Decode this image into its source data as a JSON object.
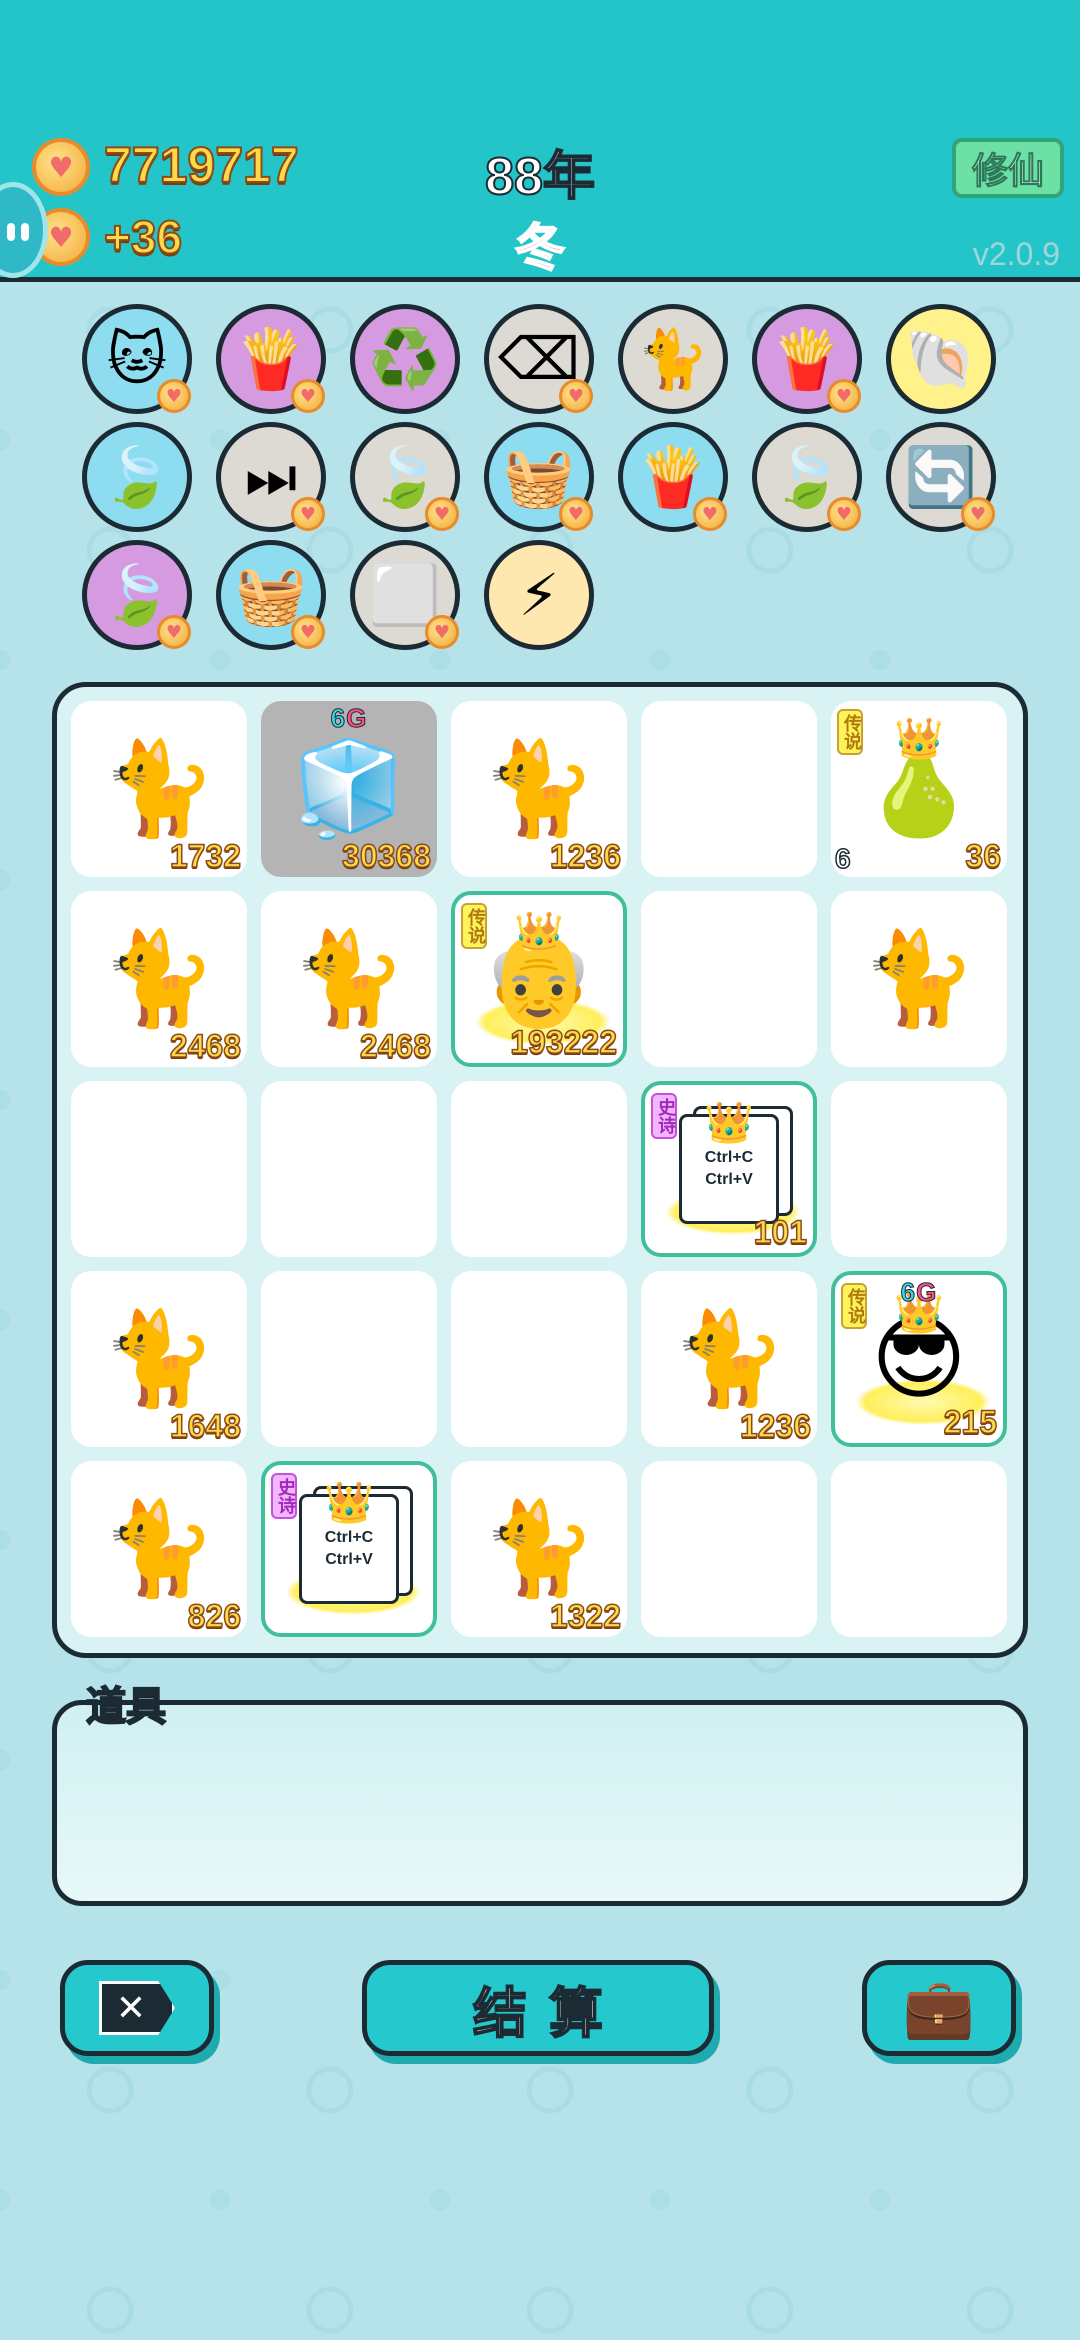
{
  "header": {
    "coins": "7719717",
    "income": "+36",
    "year": "88年",
    "season": "冬",
    "xiuxian_label": "修仙",
    "version": "v2.0.9"
  },
  "skills": [
    {
      "icon": "cat-icon",
      "glyph": "🐱",
      "color": "blue"
    },
    {
      "icon": "fries-icon",
      "glyph": "🍟",
      "color": "purple"
    },
    {
      "icon": "recycle-icon",
      "glyph": "♻️",
      "color": "purple"
    },
    {
      "icon": "delete-tag-icon",
      "glyph": "⌫",
      "color": "gray"
    },
    {
      "icon": "cats-pair-icon",
      "glyph": "🐈",
      "color": "gray"
    },
    {
      "icon": "fries-icon",
      "glyph": "🍟",
      "color": "purple"
    },
    {
      "icon": "shell-icon",
      "glyph": "🐚",
      "color": "yellow"
    },
    {
      "icon": "leaf-icon",
      "glyph": "🍃",
      "color": "blue"
    },
    {
      "icon": "skip-icon",
      "glyph": "⏭",
      "color": "gray"
    },
    {
      "icon": "leaf-icon",
      "glyph": "🍃",
      "color": "gray"
    },
    {
      "icon": "fruit-basket-icon",
      "glyph": "🧺",
      "color": "blue"
    },
    {
      "icon": "fries-icon",
      "glyph": "🍟",
      "color": "blue"
    },
    {
      "icon": "leaf-icon",
      "glyph": "🍃",
      "color": "gray"
    },
    {
      "icon": "refresh-icon",
      "glyph": "🔄",
      "color": "gray"
    },
    {
      "icon": "leaf-icon",
      "glyph": "🍃",
      "color": "purple"
    },
    {
      "icon": "fruit-basket-icon",
      "glyph": "🧺",
      "color": "blue"
    },
    {
      "icon": "sugar-cubes-icon",
      "glyph": "⬜",
      "color": "gray"
    },
    {
      "icon": "lightning-icon",
      "glyph": "⚡",
      "color": "orange"
    }
  ],
  "board": [
    {
      "item": "cat",
      "value": "1732"
    },
    {
      "item": "fridge",
      "value": "30368",
      "badge": "6G",
      "gray": true
    },
    {
      "item": "cat",
      "value": "1236"
    },
    {
      "item": "empty"
    },
    {
      "item": "pear",
      "value": "36",
      "level": "6",
      "tag": "传说"
    },
    {
      "item": "cat",
      "value": "2468"
    },
    {
      "item": "cat",
      "value": "2468"
    },
    {
      "item": "old-man",
      "value": "193222",
      "tag": "传说",
      "framed": true
    },
    {
      "item": "empty"
    },
    {
      "item": "cat",
      "value": ""
    },
    {
      "item": "empty"
    },
    {
      "item": "empty"
    },
    {
      "item": "empty"
    },
    {
      "item": "ctrl-paper",
      "value": "101",
      "tag": "史诗",
      "framed": true
    },
    {
      "item": "empty"
    },
    {
      "item": "cat",
      "value": "1648"
    },
    {
      "item": "empty"
    },
    {
      "item": "empty"
    },
    {
      "item": "cat",
      "value": "1236"
    },
    {
      "item": "sunglasses-man",
      "value": "215",
      "badge": "6G",
      "tag": "传说",
      "framed": true
    },
    {
      "item": "cat",
      "value": "826"
    },
    {
      "item": "ctrl-paper",
      "value": "",
      "tag": "史诗",
      "framed": true
    },
    {
      "item": "cat",
      "value": "1322"
    },
    {
      "item": "empty"
    },
    {
      "item": "empty"
    }
  ],
  "paper_lines": [
    "Ctrl+C",
    "Ctrl+V"
  ],
  "props": {
    "label": "道具"
  },
  "buttons": {
    "settle_label": "结算"
  }
}
